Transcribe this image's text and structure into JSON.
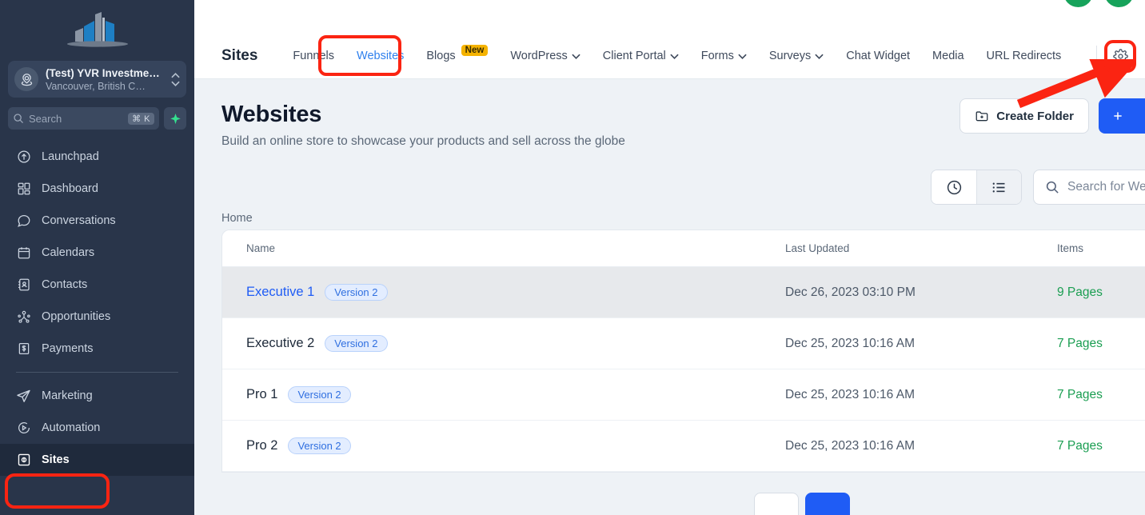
{
  "sidebar": {
    "logo_name": "building-skyline-logo",
    "account": {
      "name": "(Test) YVR Investme…",
      "location": "Vancouver, British C…"
    },
    "search": {
      "placeholder": "Search",
      "shortcut": "⌘ K"
    },
    "items": [
      {
        "label": "Launchpad",
        "icon": "rocket-launch-icon",
        "active": false
      },
      {
        "label": "Dashboard",
        "icon": "dashboard-grid-icon",
        "active": false
      },
      {
        "label": "Conversations",
        "icon": "chat-bubble-icon",
        "active": false
      },
      {
        "label": "Calendars",
        "icon": "calendar-icon",
        "active": false
      },
      {
        "label": "Contacts",
        "icon": "contacts-book-icon",
        "active": false
      },
      {
        "label": "Opportunities",
        "icon": "opportunities-icon",
        "active": false
      }
    ],
    "items_lower": [
      {
        "label": "Marketing",
        "icon": "paper-plane-icon",
        "active": false
      },
      {
        "label": "Automation",
        "icon": "play-circle-icon",
        "active": false
      },
      {
        "label": "Sites",
        "icon": "sites-window-icon",
        "active": true
      }
    ]
  },
  "topbar": {
    "section_title": "Sites",
    "tabs": [
      {
        "label": "Funnels",
        "selected": false,
        "caret": false,
        "badge": null
      },
      {
        "label": "Websites",
        "selected": true,
        "caret": false,
        "badge": null
      },
      {
        "label": "Blogs",
        "selected": false,
        "caret": false,
        "badge": "New"
      },
      {
        "label": "WordPress",
        "selected": false,
        "caret": true,
        "badge": null
      },
      {
        "label": "Client Portal",
        "selected": false,
        "caret": true,
        "badge": null
      },
      {
        "label": "Forms",
        "selected": false,
        "caret": true,
        "badge": null
      },
      {
        "label": "Surveys",
        "selected": false,
        "caret": true,
        "badge": null
      },
      {
        "label": "Chat Widget",
        "selected": false,
        "caret": false,
        "badge": null
      },
      {
        "label": "Media",
        "selected": false,
        "caret": false,
        "badge": null
      },
      {
        "label": "URL Redirects",
        "selected": false,
        "caret": false,
        "badge": null
      }
    ],
    "settings_icon": "gear-icon"
  },
  "floating_actions": [
    {
      "icon": "phone-icon",
      "color": "#17a35b",
      "has_notification": false
    },
    {
      "icon": "megaphone-icon",
      "color": "#17a35b",
      "has_notification": true
    }
  ],
  "page": {
    "title": "Websites",
    "subtitle": "Build an online store to showcase your products and sell across the globe",
    "create_folder_label": "Create Folder",
    "breadcrumb": "Home"
  },
  "toolbar": {
    "history_icon": "clock-history-icon",
    "list_icon": "list-view-icon",
    "search_placeholder": "Search for Website"
  },
  "table": {
    "columns": [
      "Name",
      "Last Updated",
      "Items"
    ],
    "rows": [
      {
        "name": "Executive 1",
        "version": "Version 2",
        "updated": "Dec 26, 2023 03:10 PM",
        "items": "9 Pages",
        "hovered": true
      },
      {
        "name": "Executive 2",
        "version": "Version 2",
        "updated": "Dec 25, 2023 10:16 AM",
        "items": "7 Pages",
        "hovered": false
      },
      {
        "name": "Pro 1",
        "version": "Version 2",
        "updated": "Dec 25, 2023 10:16 AM",
        "items": "7 Pages",
        "hovered": false
      },
      {
        "name": "Pro 2",
        "version": "Version 2",
        "updated": "Dec 25, 2023 10:16 AM",
        "items": "7 Pages",
        "hovered": false
      }
    ]
  },
  "annotations": {
    "color": "#fb2412",
    "boxes": [
      "sites-sidebar-item",
      "websites-tab",
      "settings-gear"
    ],
    "arrow_target": "settings-gear"
  },
  "colors": {
    "sidebar_bg": "#29354a",
    "content_bg": "#eef2f6",
    "accent_blue": "#1f5cf5",
    "link_blue": "#2f80ed",
    "green": "#17a35b",
    "pages_green": "#1b9e52",
    "badge_yellow": "#f5b301",
    "annotation_red": "#fb2412"
  }
}
